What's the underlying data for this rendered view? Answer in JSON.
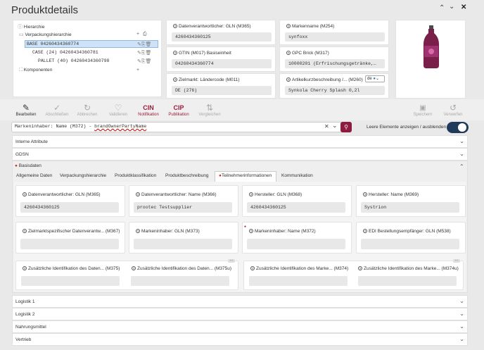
{
  "header": {
    "title": "Produktdetails",
    "nav_up": "⌃",
    "nav_down": "⌄",
    "close": "✕"
  },
  "hierarchy": {
    "title": "Hierarchie",
    "packaging_label": "Verpackungshierarchie",
    "nodes": [
      {
        "type": "BASE",
        "text": "BASE 04260434360774"
      },
      {
        "type": "CASE",
        "text": "CASE (24) 04260434360781"
      },
      {
        "type": "PALLET",
        "text": "PALLET (40) 04260434360798"
      }
    ],
    "components_label": "Komponenten"
  },
  "fields_top": {
    "gln_label": "Datenverantwortlicher: GLN (M365)",
    "gln_value": "4260434360125",
    "gtin_label": "GTIN (M017) Basiseinheit",
    "gtin_value": "04260434360774",
    "target_label": "Zielmarkt: Ländercode (M011)",
    "target_value": "DE (276)",
    "brand_label": "Markenname (M254)",
    "brand_value": "synfoxx",
    "gpc_label": "GPC Brick (M317)",
    "gpc_value": "10000201 (Erfrischungsgetränke,…",
    "short_desc_label": "Artikelkurzbeschreibung /... (M260)",
    "short_desc_value": "Synkola Cherry Splash 0,2l",
    "lang": "de"
  },
  "toolbar": {
    "items": [
      {
        "label": "Bearbeiten",
        "icon": "✎",
        "active": true
      },
      {
        "label": "Abschließen",
        "icon": "✓",
        "active": false
      },
      {
        "label": "Abbrechen",
        "icon": "↻",
        "active": false
      },
      {
        "label": "Validieren",
        "icon": "♡",
        "active": false
      },
      {
        "label": "Notifikation",
        "icon": "CIN",
        "active": true
      },
      {
        "label": "Publikation",
        "icon": "CIP",
        "active": true
      },
      {
        "label": "Vergleichen",
        "icon": "⇅",
        "active": false
      }
    ],
    "right": [
      {
        "label": "Speichern",
        "icon": "💾"
      },
      {
        "label": "Verwerfen",
        "icon": "↺"
      }
    ]
  },
  "search": {
    "value_prefix": "Markeninhaber: Name (M372) - ",
    "value_highlight": "brandOwnerPartyName",
    "toggle_label": "Leere Elemente anzeigen / ausblenden"
  },
  "sections": {
    "intern": "Interne Attribute",
    "gdsn": "GDSN",
    "basis": "Basisdaten",
    "log1": "Logistik 1",
    "log2": "Logistik 2",
    "food": "Nahrungsmittel",
    "sales": "Vertrieb"
  },
  "tabs": [
    "Allgemeine Daten",
    "Verpackungshierarchie",
    "Produktklassifikation",
    "Produktbeschreibung",
    "Teilnehmerinformationen",
    "Kommunikation"
  ],
  "participants": {
    "row1": [
      {
        "label": "Datenverantwortlicher: GLN (M365)",
        "value": "4260434360125"
      },
      {
        "label": "Datenverantwortlicher: Name (M366)",
        "value": "prootec Testsupplier"
      },
      {
        "label": "Hersteller: GLN (M368)",
        "value": "4260434360125"
      },
      {
        "label": "Hersteller: Name (M369)",
        "value": "Systrion"
      }
    ],
    "row2": [
      {
        "label": "Zielmarktspezifischer Datenverantw... (M367)",
        "value": ""
      },
      {
        "label": "Markeninhaber: GLN (M373)",
        "value": ""
      },
      {
        "label": "Markeninhaber: Name (M372)",
        "value": ""
      },
      {
        "label": "EDI Bestellungsempfänger: GLN (M538)",
        "value": ""
      }
    ],
    "row3": [
      {
        "label": "Zusätzliche Identifikation des Daten... (M375)",
        "value": ""
      },
      {
        "label": "Zusätzliche Identifikation des Daten... (M375u)",
        "value": ""
      },
      {
        "label": "Zusätzliche Identifikation des Marke... (M374)",
        "value": ""
      },
      {
        "label": "Zusätzliche Identifikation des Marke... (M374u)",
        "value": ""
      }
    ]
  },
  "colors": {
    "accent": "#9c1c3c",
    "search_btn": "#8e1a3f",
    "toggle": "#1f3a5a"
  }
}
